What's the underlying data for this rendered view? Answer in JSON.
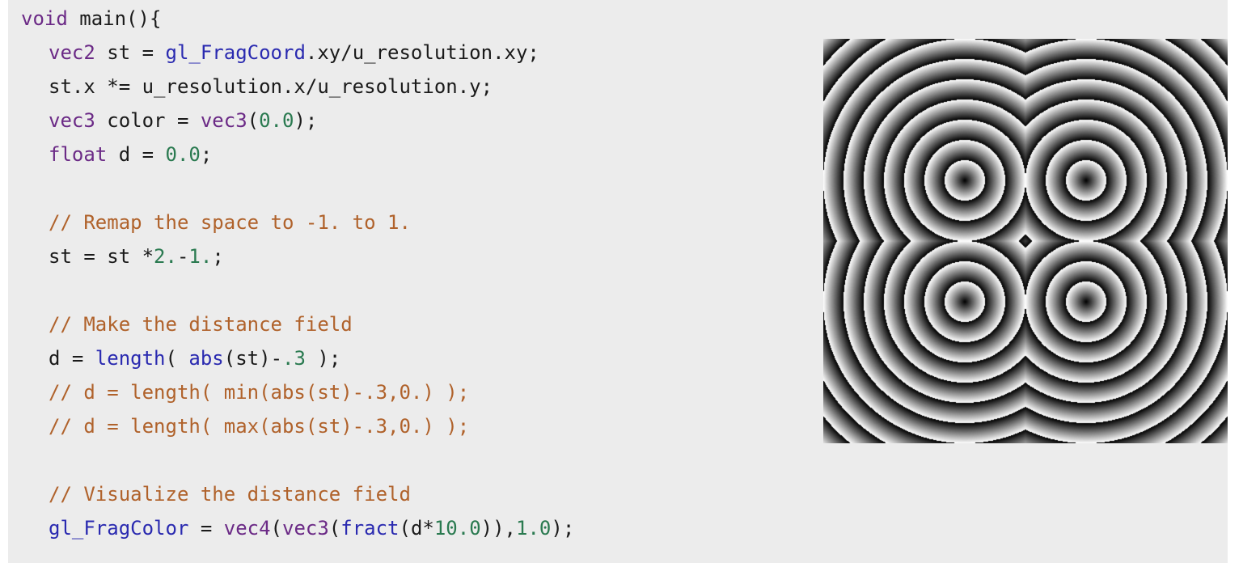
{
  "editor": {
    "lines": [
      [
        {
          "t": "void",
          "c": "kw"
        },
        {
          "t": " main(){",
          "c": ""
        }
      ],
      [
        {
          "t": "vec2",
          "c": "kw"
        },
        {
          "t": " st = ",
          "c": ""
        },
        {
          "t": "gl_FragCoord",
          "c": "fn"
        },
        {
          "t": ".xy/u_resolution.xy;",
          "c": ""
        }
      ],
      [
        {
          "t": "st.x *= u_resolution.x/u_resolution.y;",
          "c": ""
        }
      ],
      [
        {
          "t": "vec3",
          "c": "kw"
        },
        {
          "t": " color = ",
          "c": ""
        },
        {
          "t": "vec3",
          "c": "kw"
        },
        {
          "t": "(",
          "c": ""
        },
        {
          "t": "0.0",
          "c": "num"
        },
        {
          "t": ");",
          "c": ""
        }
      ],
      [
        {
          "t": "float",
          "c": "kw"
        },
        {
          "t": " d = ",
          "c": ""
        },
        {
          "t": "0.0",
          "c": "num"
        },
        {
          "t": ";",
          "c": ""
        }
      ],
      [],
      [
        {
          "t": "// Remap the space to -1. to 1.",
          "c": "cm"
        }
      ],
      [
        {
          "t": "st = st *",
          "c": ""
        },
        {
          "t": "2.",
          "c": "num"
        },
        {
          "t": "-",
          "c": ""
        },
        {
          "t": "1.",
          "c": "num"
        },
        {
          "t": ";",
          "c": ""
        }
      ],
      [],
      [
        {
          "t": "// Make the distance field",
          "c": "cm"
        }
      ],
      [
        {
          "t": "d = ",
          "c": ""
        },
        {
          "t": "length",
          "c": "fn"
        },
        {
          "t": "( ",
          "c": ""
        },
        {
          "t": "abs",
          "c": "fn"
        },
        {
          "t": "(st)-",
          "c": ""
        },
        {
          "t": ".3",
          "c": "num"
        },
        {
          "t": " );",
          "c": ""
        }
      ],
      [
        {
          "t": "// d = length( min(abs(st)-.3,0.) );",
          "c": "cm"
        }
      ],
      [
        {
          "t": "// d = length( max(abs(st)-.3,0.) );",
          "c": "cm"
        }
      ],
      [],
      [
        {
          "t": "// Visualize the distance field",
          "c": "cm"
        }
      ],
      [
        {
          "t": "gl_FragColor",
          "c": "fn"
        },
        {
          "t": " = ",
          "c": ""
        },
        {
          "t": "vec4",
          "c": "kw"
        },
        {
          "t": "(",
          "c": ""
        },
        {
          "t": "vec3",
          "c": "kw"
        },
        {
          "t": "(",
          "c": ""
        },
        {
          "t": "fract",
          "c": "fn"
        },
        {
          "t": "(d*",
          "c": ""
        },
        {
          "t": "10.0",
          "c": "num"
        },
        {
          "t": ")),",
          "c": ""
        },
        {
          "t": "1.0",
          "c": "num"
        },
        {
          "t": ");",
          "c": ""
        }
      ]
    ],
    "colors": {
      "background": "#ececec",
      "keyword": "#6b2a86",
      "function": "#2a2ab0",
      "number": "#2a7a50",
      "comment": "#b0622b",
      "text": "#1a1a1a"
    }
  },
  "preview": {
    "shader": "fract(length(abs(st)-.3)*10.0)"
  }
}
